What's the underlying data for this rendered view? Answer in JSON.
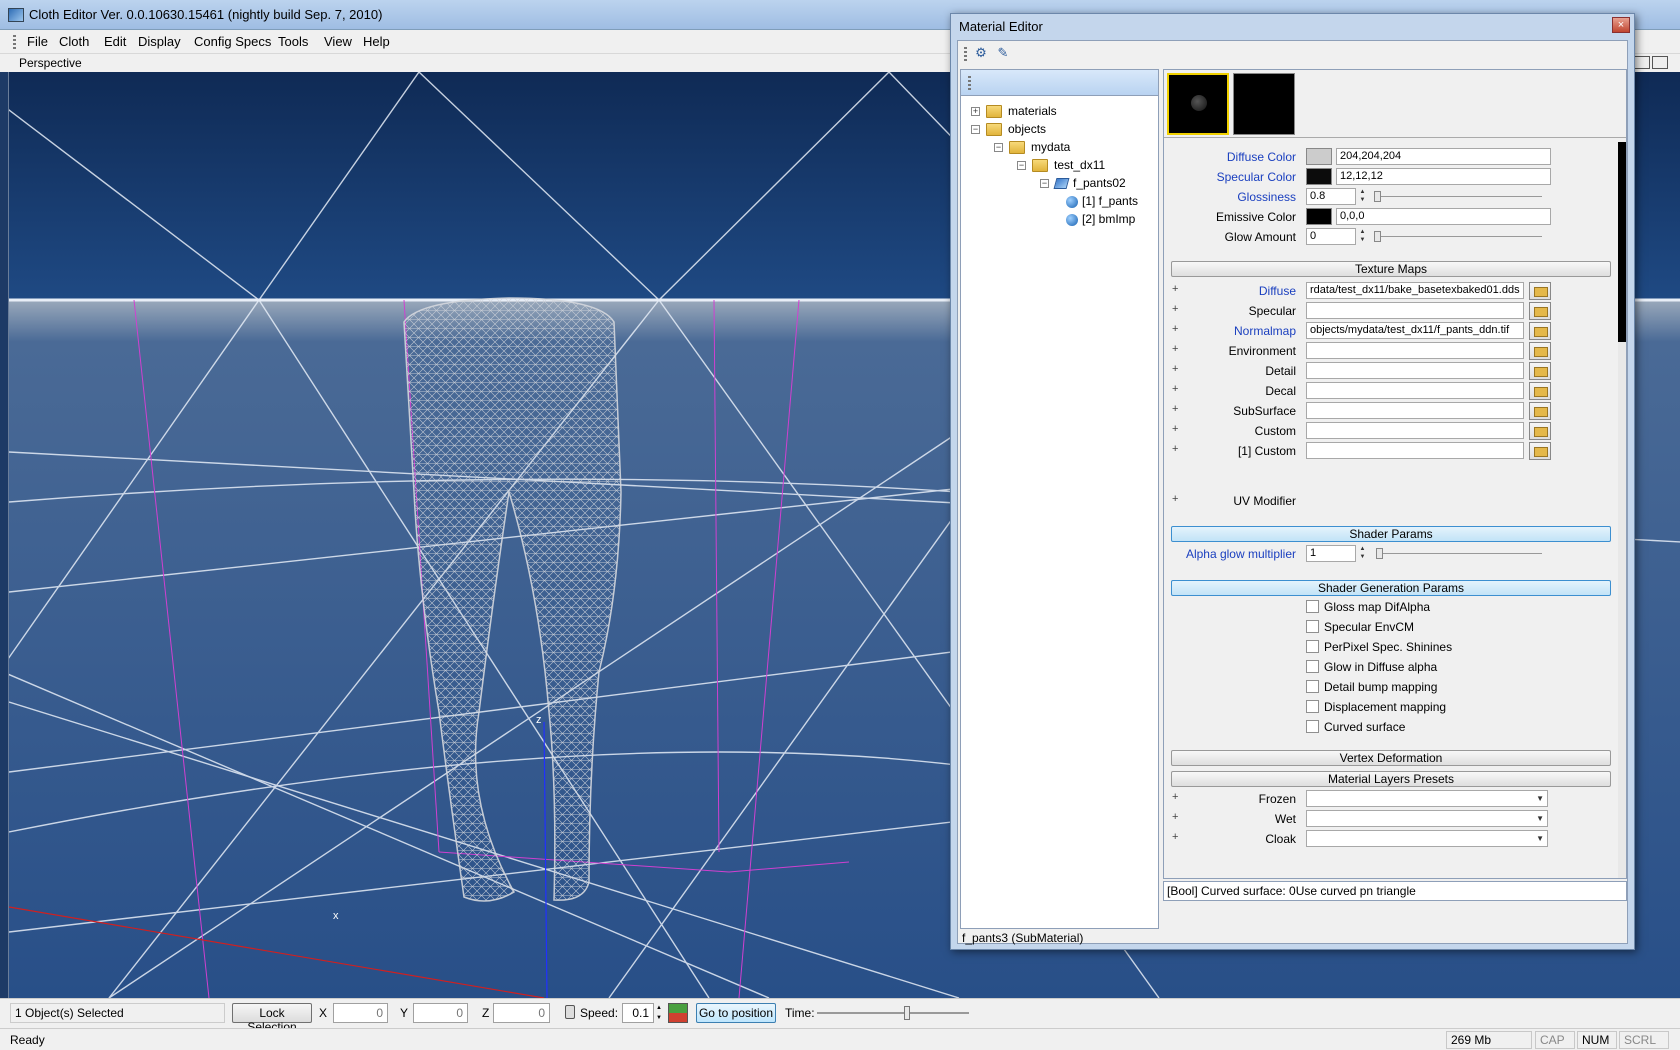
{
  "window": {
    "title": "Cloth Editor Ver. 0.0.10630.15461 (nightly build Sep. 7, 2010)",
    "menu": [
      "File",
      "Cloth",
      "Edit",
      "Display",
      "Config Specs",
      "Tools",
      "View",
      "Help"
    ],
    "viewport_label": "Perspective",
    "axis_labels": {
      "z": "z",
      "x": "x"
    }
  },
  "bottom_toolbar": {
    "selection": "1 Object(s) Selected",
    "lock_selection": "Lock Selection",
    "x_label": "X",
    "x_value": "0",
    "y_label": "Y",
    "y_value": "0",
    "z_label": "Z",
    "z_value": "0",
    "speed_label": "Speed:",
    "speed_value": "0.1",
    "goto_position": "Go to position",
    "time_label": "Time:"
  },
  "status_bar": {
    "ready": "Ready",
    "memory": "269 Mb",
    "cap": "CAP",
    "num": "NUM",
    "scrl": "SCRL"
  },
  "material_editor": {
    "title": "Material Editor",
    "close": "×",
    "tree": [
      {
        "label": "materials",
        "expander": "+",
        "type": "folder",
        "depth": 0
      },
      {
        "label": "objects",
        "expander": "−",
        "type": "folder",
        "depth": 0
      },
      {
        "label": "mydata",
        "expander": "−",
        "type": "folder",
        "depth": 1
      },
      {
        "label": "test_dx11",
        "expander": "−",
        "type": "folder",
        "depth": 2
      },
      {
        "label": "f_pants02",
        "expander": "−",
        "type": "object",
        "depth": 3
      },
      {
        "label": "[1] f_pants",
        "expander": "",
        "type": "submaterial",
        "depth": 4
      },
      {
        "label": "[2] bmImp",
        "expander": "",
        "type": "submaterial",
        "depth": 4
      }
    ],
    "footer": "f_pants3 (SubMaterial)",
    "colors": {
      "diffuse_label": "Diffuse Color",
      "diffuse_value": "204,204,204",
      "diffuse_swatch": "#cccccc",
      "specular_label": "Specular Color",
      "specular_value": "12,12,12",
      "specular_swatch": "#0c0c0c",
      "glossiness_label": "Glossiness",
      "glossiness_value": "0.8",
      "emissive_label": "Emissive Color",
      "emissive_value": "0,0,0",
      "emissive_swatch": "#000000",
      "glow_label": "Glow Amount",
      "glow_value": "0"
    },
    "texture_maps": {
      "header": "Texture Maps",
      "rows": [
        {
          "label": "Diffuse",
          "value": "rdata/test_dx11/bake_basetexbaked01.dds",
          "link": true
        },
        {
          "label": "Specular",
          "value": "",
          "link": false
        },
        {
          "label": "Normalmap",
          "value": "objects/mydata/test_dx11/f_pants_ddn.tif",
          "link": true
        },
        {
          "label": "Environment",
          "value": "",
          "link": false
        },
        {
          "label": "Detail",
          "value": "",
          "link": false
        },
        {
          "label": "Decal",
          "value": "",
          "link": false
        },
        {
          "label": "SubSurface",
          "value": "",
          "link": false
        },
        {
          "label": "Custom",
          "value": "",
          "link": false
        },
        {
          "label": "[1] Custom",
          "value": "",
          "link": false
        }
      ],
      "uv_modifier": "UV Modifier"
    },
    "shader_params": {
      "header": "Shader Params",
      "alpha_glow_label": "Alpha glow multiplier",
      "alpha_glow_value": "1"
    },
    "shader_generation": {
      "header": "Shader Generation Params",
      "options": [
        "Gloss map DifAlpha",
        "Specular EnvCM",
        "PerPixel Spec. Shinines",
        "Glow in Diffuse alpha",
        "Detail bump mapping",
        "Displacement mapping",
        "Curved surface"
      ]
    },
    "vertex_deformation": "Vertex Deformation",
    "material_layers": {
      "header": "Material Layers Presets",
      "rows": [
        "Frozen",
        "Wet",
        "Cloak"
      ]
    },
    "status": "[Bool] Curved surface: 0Use curved pn triangle"
  }
}
